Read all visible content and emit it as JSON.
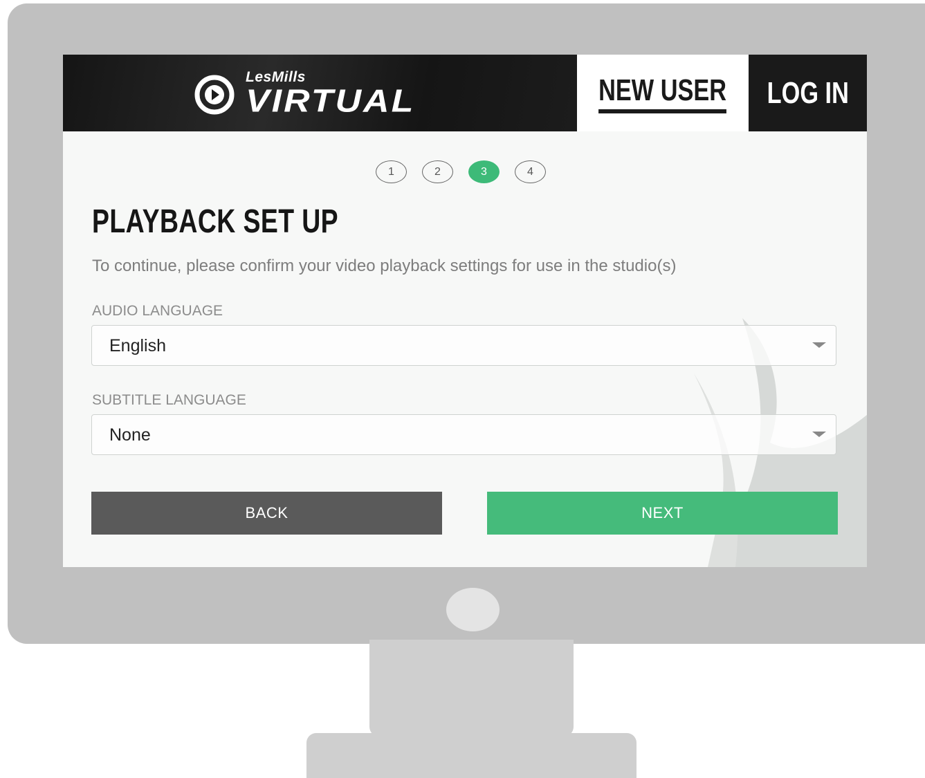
{
  "header": {
    "logo_top": "LesMills",
    "logo_main": "VIRTUAL",
    "tab_new_user": "NEW USER",
    "tab_log_in": "LOG IN"
  },
  "steps": {
    "items": [
      "1",
      "2",
      "3",
      "4"
    ],
    "active": "3",
    "accent_color": "#3dba78"
  },
  "page": {
    "title": "PLAYBACK SET UP",
    "description": "To continue, please confirm your video playback settings for use in the studio(s)"
  },
  "audio": {
    "label": "AUDIO LANGUAGE",
    "value": "English"
  },
  "subtitle": {
    "label": "SUBTITLE LANGUAGE",
    "value": "None"
  },
  "actions": {
    "back_label": "BACK",
    "next_label": "NEXT",
    "back_color": "#5a5a5a",
    "next_color": "#45bb7b"
  }
}
